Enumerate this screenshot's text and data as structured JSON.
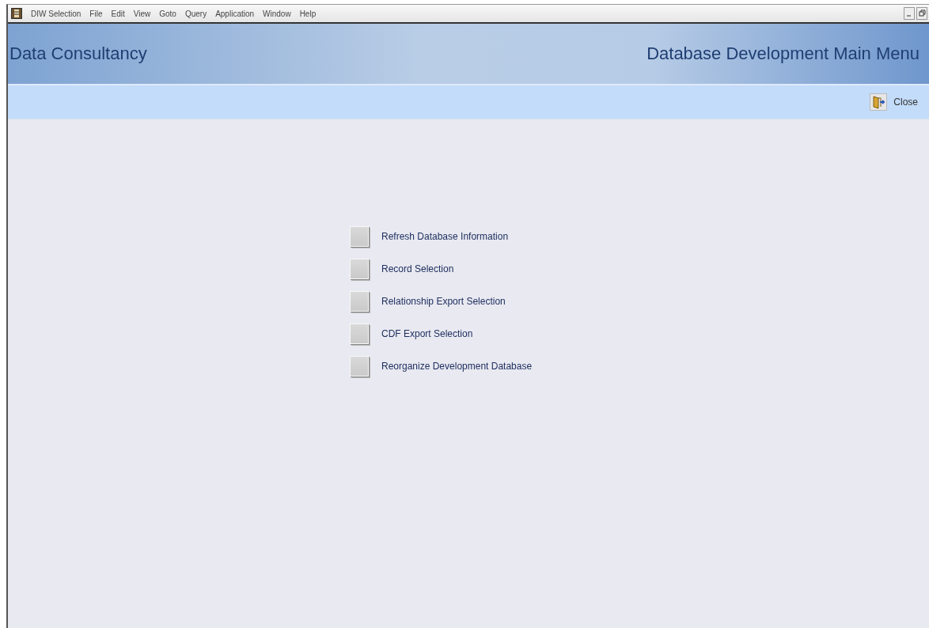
{
  "menu_bar": {
    "items": [
      "DIW Selection",
      "File",
      "Edit",
      "View",
      "Goto",
      "Query",
      "Application",
      "Window",
      "Help"
    ]
  },
  "header": {
    "company": "Data Consultancy",
    "title": "Database Development Main Menu"
  },
  "toolbar": {
    "close_label": "Close"
  },
  "menu_options": [
    {
      "label": "Refresh Database Information"
    },
    {
      "label": "Record Selection"
    },
    {
      "label": "Relationship Export Selection"
    },
    {
      "label": "CDF Export Selection"
    },
    {
      "label": "Reorganize Development Database"
    }
  ]
}
